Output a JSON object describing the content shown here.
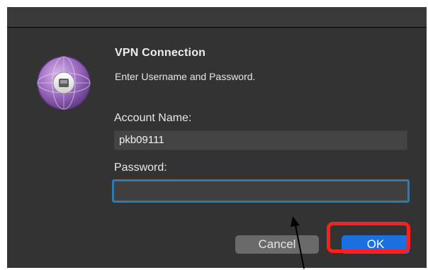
{
  "dialog": {
    "heading": "VPN Connection",
    "subheading": "Enter Username and Password.",
    "account_label": "Account Name:",
    "account_value": "pkb09111",
    "password_label": "Password:",
    "password_value": "",
    "cancel_label": "Cancel",
    "ok_label": "OK",
    "icon": "vpn-network-globe-icon"
  },
  "annotations": {
    "highlight_color": "#ff1f1f",
    "highlight_target": "ok-button",
    "arrow_color": "#000000",
    "arrow_target": "password-field"
  },
  "colors": {
    "dialog_background": "#333333",
    "ok_button": "#1b6fe0",
    "focus_ring": "#2f7bb1"
  }
}
